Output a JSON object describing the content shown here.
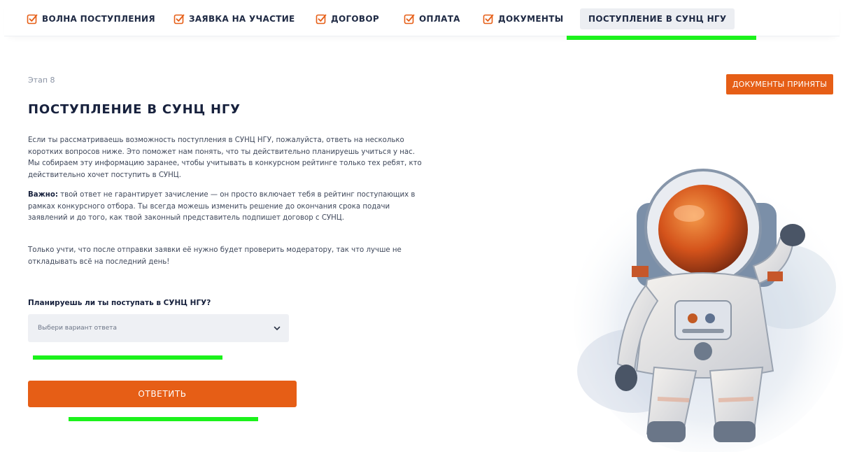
{
  "nav": {
    "tabs": [
      {
        "label": "ВОЛНА ПОСТУПЛЕНИЯ",
        "done": true
      },
      {
        "label": "ЗАЯВКА НА УЧАСТИЕ",
        "done": true
      },
      {
        "label": "ДОГОВОР",
        "done": true
      },
      {
        "label": "ОПЛАТА",
        "done": true
      },
      {
        "label": "ДОКУМЕНТЫ",
        "done": true
      },
      {
        "label": "ПОСТУПЛЕНИЕ В СУНЦ НГУ",
        "done": false,
        "active": true
      }
    ]
  },
  "colors": {
    "accent": "#e65e16",
    "title": "#17213d",
    "highlight": "#1bf21b"
  },
  "stage_label": "Этап 8",
  "status_badge": "ДОКУМЕНТЫ ПРИНЯТЫ",
  "title": "ПОСТУПЛЕНИЕ В СУНЦ НГУ",
  "paragraphs": {
    "p1": "Если ты рассматриваешь возможность поступления в СУНЦ НГУ, пожалуйста, ответь на несколько коротких вопросов ниже. Это поможет нам понять, что ты действительно планируешь учиться у нас. Мы собираем эту информацию заранее, чтобы учитывать в конкурсном рейтинге только тех ребят, кто действительно хочет поступить в СУНЦ.",
    "p2_bold": "Важно:",
    "p2": " твой ответ не гарантирует зачисление — он просто включает тебя в рейтинг поступающих в рамках конкурсного отбора. Ты всегда можешь изменить решение до окончания срока подачи заявлений и до того, как твой законный представитель подпишет договор с СУНЦ.",
    "p3": "Только учти, что после отправки заявки её нужно будет проверить модератору, так что лучше не откладывать всё на последний день!"
  },
  "form": {
    "question": "Планируешь ли ты поступать в СУНЦ НГУ?",
    "select_placeholder": "Выбери вариант ответа",
    "submit_label": "ОТВЕТИТЬ"
  },
  "icons": {
    "tab_check": "checkbox-checked-icon",
    "select_arrow": "chevron-down-icon",
    "illustration": "astronaut-illustration"
  }
}
